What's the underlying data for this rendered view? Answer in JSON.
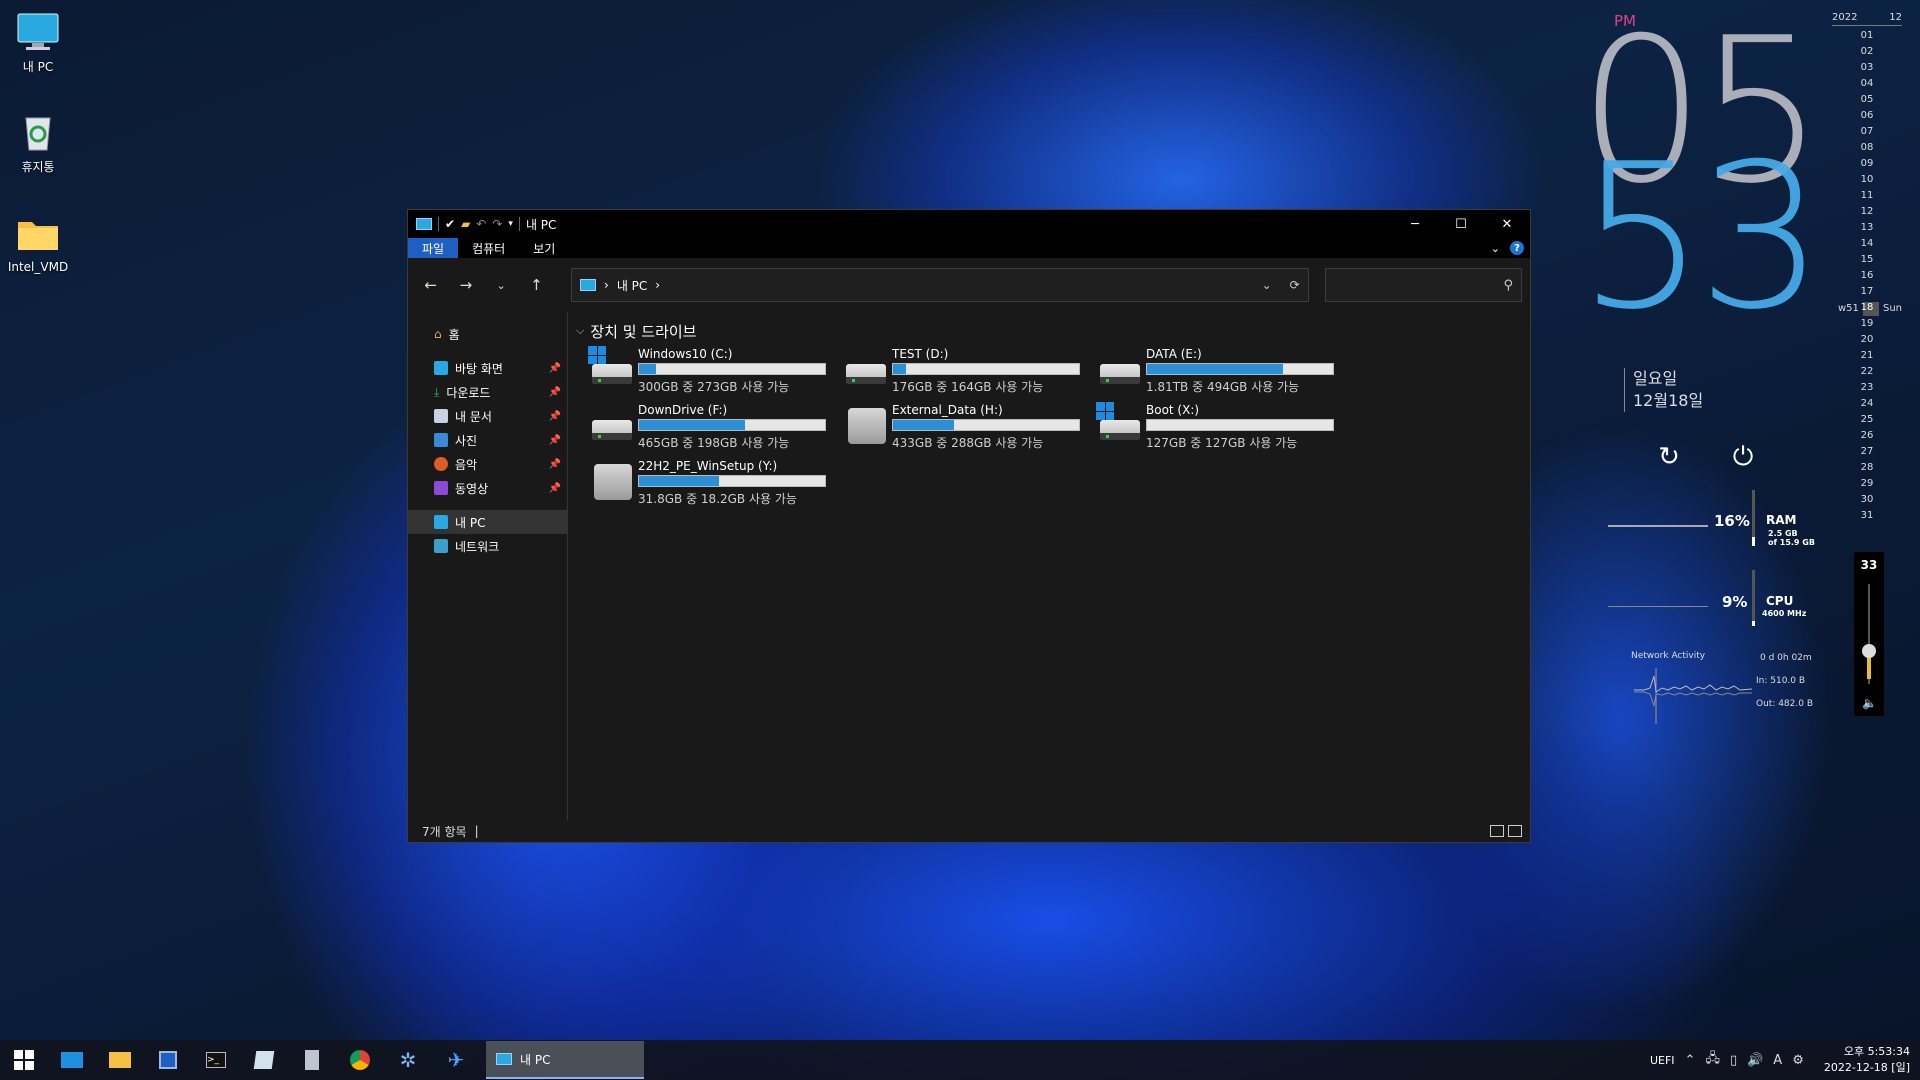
{
  "desktop": {
    "icons": [
      {
        "label": "내 PC"
      },
      {
        "label": "휴지통"
      },
      {
        "label": "Intel_VMD"
      }
    ]
  },
  "window": {
    "title": "내 PC",
    "ribbon_tabs": [
      "파일",
      "컴퓨터",
      "보기"
    ],
    "address": {
      "location": "내 PC"
    },
    "sidebar": {
      "home": "홈",
      "quick": [
        "바탕 화면",
        "다운로드",
        "내 문서",
        "사진",
        "음악",
        "동영상"
      ],
      "this_pc": "내 PC",
      "network": "네트워크"
    },
    "group_title": "장치 및 드라이브",
    "drives": [
      {
        "name": "Windows10 (C:)",
        "free": "300GB 중 273GB 사용 가능",
        "used_fraction": 0.09,
        "icon": "hdd-windows"
      },
      {
        "name": "TEST (D:)",
        "free": "176GB 중 164GB 사용 가능",
        "used_fraction": 0.07,
        "icon": "hdd"
      },
      {
        "name": "DATA (E:)",
        "free": "1.81TB 중 494GB 사용 가능",
        "used_fraction": 0.73,
        "icon": "hdd"
      },
      {
        "name": "DownDrive (F:)",
        "free": "465GB 중 198GB 사용 가능",
        "used_fraction": 0.57,
        "icon": "hdd"
      },
      {
        "name": "External_Data (H:)",
        "free": "433GB 중 288GB 사용 가능",
        "used_fraction": 0.33,
        "icon": "usb"
      },
      {
        "name": "Boot (X:)",
        "free": "127GB 중 127GB 사용 가능",
        "used_fraction": 0.0,
        "icon": "hdd-windows"
      },
      {
        "name": "22H2_PE_WinSetup (Y:)",
        "free": "31.8GB 중 18.2GB 사용 가능",
        "used_fraction": 0.43,
        "icon": "usb"
      }
    ],
    "status": "7개 항목"
  },
  "clock_widget": {
    "ampm": "PM",
    "hour": "05",
    "minute": "53",
    "weekday": "일요일",
    "date": "12월18일"
  },
  "calendar": {
    "year": "2022",
    "month": "12",
    "days": [
      "01",
      "02",
      "03",
      "04",
      "05",
      "06",
      "07",
      "08",
      "09",
      "10",
      "11",
      "12",
      "13",
      "14",
      "15",
      "16",
      "17",
      "18",
      "19",
      "20",
      "21",
      "22",
      "23",
      "24",
      "25",
      "26",
      "27",
      "28",
      "29",
      "30",
      "31"
    ],
    "today": "18",
    "week": "w51",
    "weekday": "Sun"
  },
  "system_meters": {
    "ram": {
      "percent": "16%",
      "label": "RAM",
      "detail1": "2.5 GB",
      "detail2": "of 15.9 GB",
      "fraction": 0.16
    },
    "cpu": {
      "percent": "9%",
      "label": "CPU",
      "detail": "4600 MHz",
      "fraction": 0.09
    },
    "network": {
      "title": "Network Activity",
      "uptime": "0 d 0h 02m",
      "in": "In: 510.0 B",
      "out": "Out: 482.0 B"
    },
    "volume": {
      "level": "33"
    }
  },
  "taskbar": {
    "active_window": "내 PC",
    "tray_label": "UEFI",
    "time": "오후 5:53:34",
    "date": "2022-12-18 [일]"
  },
  "colors": {
    "accent": "#2b8fd6",
    "clock_minute": "#46aae6",
    "pm": "#e3408c"
  }
}
